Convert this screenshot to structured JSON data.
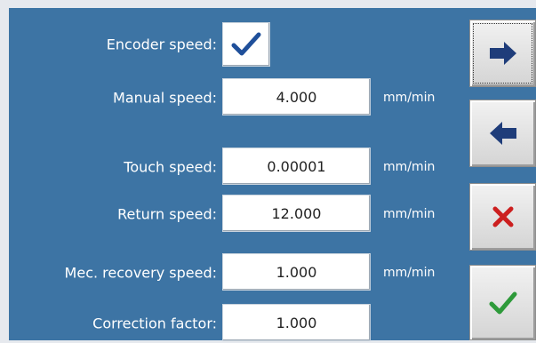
{
  "rows": [
    {
      "label": "Encoder speed:",
      "type": "checkbox",
      "checked": true
    },
    {
      "label": "Manual speed:",
      "value": "4.000",
      "unit": "mm/min"
    },
    {
      "label": "Touch speed:",
      "value": "0.00001",
      "unit": "mm/min"
    },
    {
      "label": "Return speed:",
      "value": "12.000",
      "unit": "mm/min"
    },
    {
      "label": "Mec. recovery speed:",
      "value": "1.000",
      "unit": "mm/min"
    },
    {
      "label": "Correction factor:",
      "value": "1.000"
    }
  ],
  "buttons": [
    {
      "name": "next",
      "icon": "arrow-right-icon"
    },
    {
      "name": "back",
      "icon": "arrow-left-icon"
    },
    {
      "name": "cancel",
      "icon": "x-icon"
    },
    {
      "name": "confirm",
      "icon": "checkmark-icon"
    }
  ],
  "colors": {
    "panel": "#3d74a4",
    "arrow": "#1f3d7a",
    "cancel": "#cc1f1f",
    "confirm": "#2e9a3a"
  }
}
